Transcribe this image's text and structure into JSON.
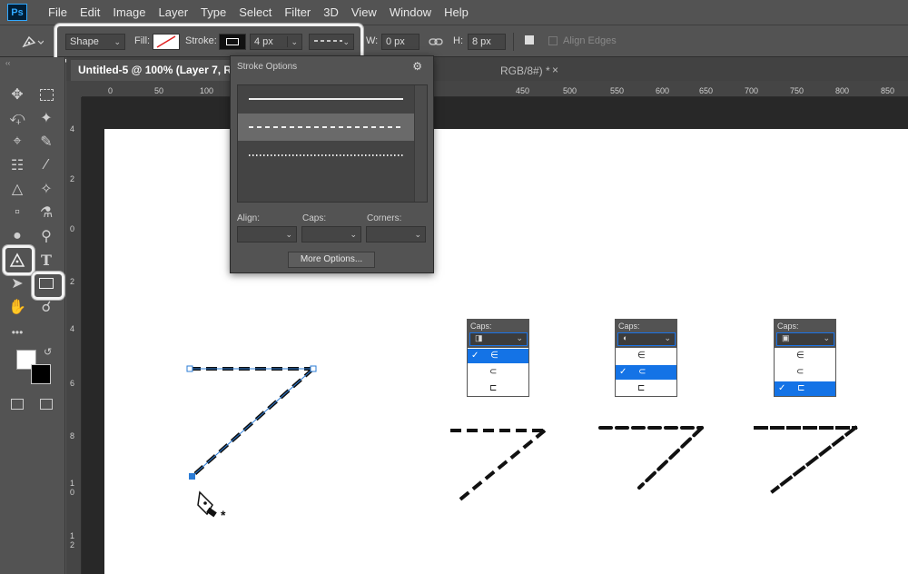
{
  "menu": [
    "File",
    "Edit",
    "Image",
    "Layer",
    "Type",
    "Select",
    "Filter",
    "3D",
    "View",
    "Window",
    "Help"
  ],
  "app_logo": "Ps",
  "options": {
    "mode": "Shape",
    "fill_label": "Fill:",
    "stroke_label": "Stroke:",
    "stroke_width": "4 px",
    "w_label": "W:",
    "w_value": "0 px",
    "h_label": "H:",
    "h_value": "8 px",
    "align_edges": "Align Edges"
  },
  "document_tab": {
    "title": "Untitled-5 @ 100% (Layer 7, RGB",
    "tail": "RGB/8#) *",
    "close": "×"
  },
  "ruler_h": [
    "0",
    "50",
    "100",
    "450",
    "500",
    "550",
    "600",
    "650",
    "700",
    "750",
    "800",
    "850"
  ],
  "ruler_v": [
    "4",
    "2",
    "0",
    "2",
    "4",
    "6",
    "8",
    "1\n0",
    "1\n2"
  ],
  "stroke_options": {
    "title": "Stroke Options",
    "align_label": "Align:",
    "caps_label": "Caps:",
    "corners_label": "Corners:",
    "more_button": "More Options..."
  },
  "caps_popups": [
    {
      "label": "Caps:",
      "selected_index": 0
    },
    {
      "label": "Caps:",
      "selected_index": 1
    },
    {
      "label": "Caps:",
      "selected_index": 2
    }
  ],
  "colors": {
    "ui_bg": "#535353",
    "selection": "#1473e6",
    "highlight_box": "#f2f2f2"
  }
}
